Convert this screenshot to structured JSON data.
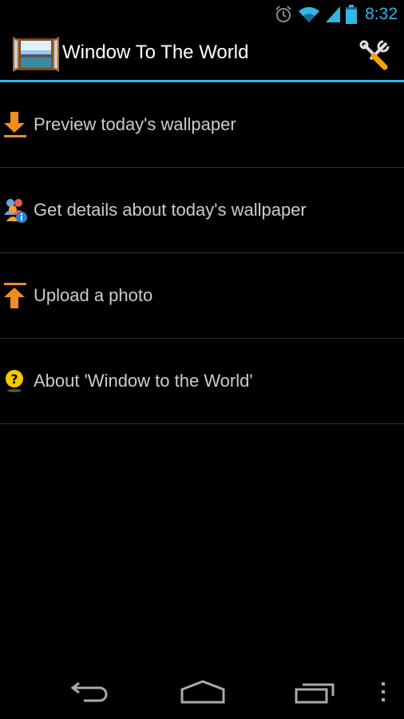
{
  "status_bar": {
    "time": "8:32",
    "icons": [
      "alarm-icon",
      "wifi-icon",
      "signal-icon",
      "battery-icon"
    ],
    "accent": "#33b5e5"
  },
  "action_bar": {
    "title": "Window To The World",
    "app_icon": "window-icon",
    "settings_icon": "tools-icon"
  },
  "menu": {
    "items": [
      {
        "label": "Preview today's wallpaper",
        "icon": "download-arrow-icon"
      },
      {
        "label": "Get details about today's wallpaper",
        "icon": "people-info-icon"
      },
      {
        "label": "Upload a photo",
        "icon": "upload-arrow-icon"
      },
      {
        "label": "About 'Window to the World'",
        "icon": "help-icon"
      }
    ]
  },
  "nav_bar": {
    "buttons": [
      "back",
      "home",
      "recent-apps",
      "menu-overflow"
    ]
  }
}
